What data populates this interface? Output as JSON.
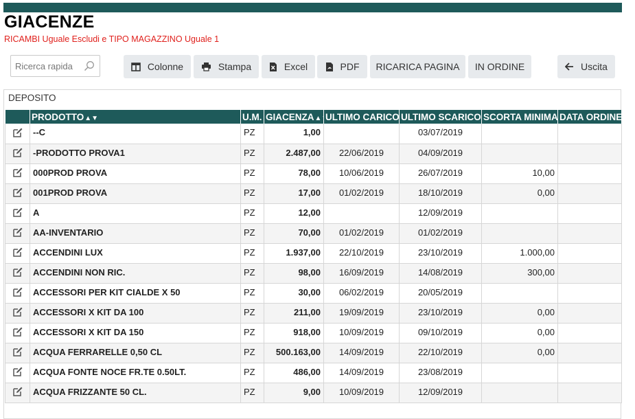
{
  "header": {
    "title": "GIACENZE",
    "filter": "RICAMBI Uguale Escludi e TIPO MAGAZZINO Uguale 1"
  },
  "search": {
    "placeholder": "Ricerca rapida"
  },
  "toolbar": {
    "colonne": "Colonne",
    "stampa": "Stampa",
    "excel": "Excel",
    "pdf": "PDF",
    "ricarica": "RICARICA PAGINA",
    "in_ordine": "IN ORDINE",
    "uscita": "Uscita"
  },
  "deposit": {
    "label": "DEPOSITO"
  },
  "table": {
    "columns": {
      "prodotto": "PRODOTTO",
      "um": "U.M.",
      "giacenza": "GIACENZA",
      "ultimo_carico": "ULTIMO CARICO",
      "ultimo_scarico": "ULTIMO SCARICO",
      "scorta_minima": "SCORTA MINIMA",
      "data_ordine": "DATA ORDINE"
    },
    "rows": [
      {
        "prodotto": "--C",
        "um": "PZ",
        "giacenza": "1,00",
        "ultimo_carico": "",
        "ultimo_scarico": "03/07/2019",
        "scorta_minima": "",
        "data_ordine": ""
      },
      {
        "prodotto": "-PRODOTTO PROVA1",
        "um": "PZ",
        "giacenza": "2.487,00",
        "ultimo_carico": "22/06/2019",
        "ultimo_scarico": "04/09/2019",
        "scorta_minima": "",
        "data_ordine": ""
      },
      {
        "prodotto": "000PROD PROVA",
        "um": "PZ",
        "giacenza": "78,00",
        "ultimo_carico": "10/06/2019",
        "ultimo_scarico": "26/07/2019",
        "scorta_minima": "10,00",
        "data_ordine": ""
      },
      {
        "prodotto": "001PROD PROVA",
        "um": "PZ",
        "giacenza": "17,00",
        "ultimo_carico": "01/02/2019",
        "ultimo_scarico": "18/10/2019",
        "scorta_minima": "0,00",
        "data_ordine": ""
      },
      {
        "prodotto": "A",
        "um": "PZ",
        "giacenza": "12,00",
        "ultimo_carico": "",
        "ultimo_scarico": "12/09/2019",
        "scorta_minima": "",
        "data_ordine": ""
      },
      {
        "prodotto": "AA-INVENTARIO",
        "um": "PZ",
        "giacenza": "70,00",
        "ultimo_carico": "01/02/2019",
        "ultimo_scarico": "01/02/2019",
        "scorta_minima": "",
        "data_ordine": ""
      },
      {
        "prodotto": "ACCENDINI LUX",
        "um": "PZ",
        "giacenza": "1.937,00",
        "ultimo_carico": "22/10/2019",
        "ultimo_scarico": "23/10/2019",
        "scorta_minima": "1.000,00",
        "data_ordine": ""
      },
      {
        "prodotto": "ACCENDINI NON RIC.",
        "um": "PZ",
        "giacenza": "98,00",
        "ultimo_carico": "16/09/2019",
        "ultimo_scarico": "14/08/2019",
        "scorta_minima": "300,00",
        "data_ordine": ""
      },
      {
        "prodotto": "ACCESSORI PER KIT CIALDE X 50",
        "um": "PZ",
        "giacenza": "30,00",
        "ultimo_carico": "06/02/2019",
        "ultimo_scarico": "20/05/2019",
        "scorta_minima": "",
        "data_ordine": ""
      },
      {
        "prodotto": "ACCESSORI X KIT DA 100",
        "um": "PZ",
        "giacenza": "211,00",
        "ultimo_carico": "19/09/2019",
        "ultimo_scarico": "23/10/2019",
        "scorta_minima": "0,00",
        "data_ordine": ""
      },
      {
        "prodotto": "ACCESSORI X KIT DA 150",
        "um": "PZ",
        "giacenza": "918,00",
        "ultimo_carico": "10/09/2019",
        "ultimo_scarico": "09/10/2019",
        "scorta_minima": "0,00",
        "data_ordine": ""
      },
      {
        "prodotto": "ACQUA FERRARELLE 0,50 CL",
        "um": "PZ",
        "giacenza": "500.163,00",
        "ultimo_carico": "14/09/2019",
        "ultimo_scarico": "22/10/2019",
        "scorta_minima": "0,00",
        "data_ordine": ""
      },
      {
        "prodotto": "ACQUA FONTE NOCE FR.TE 0.50LT.",
        "um": "PZ",
        "giacenza": "486,00",
        "ultimo_carico": "14/09/2019",
        "ultimo_scarico": "23/08/2019",
        "scorta_minima": "",
        "data_ordine": ""
      },
      {
        "prodotto": "ACQUA FRIZZANTE 50 CL.",
        "um": "PZ",
        "giacenza": "9,00",
        "ultimo_carico": "10/09/2019",
        "ultimo_scarico": "12/09/2019",
        "scorta_minima": "",
        "data_ordine": ""
      }
    ]
  }
}
